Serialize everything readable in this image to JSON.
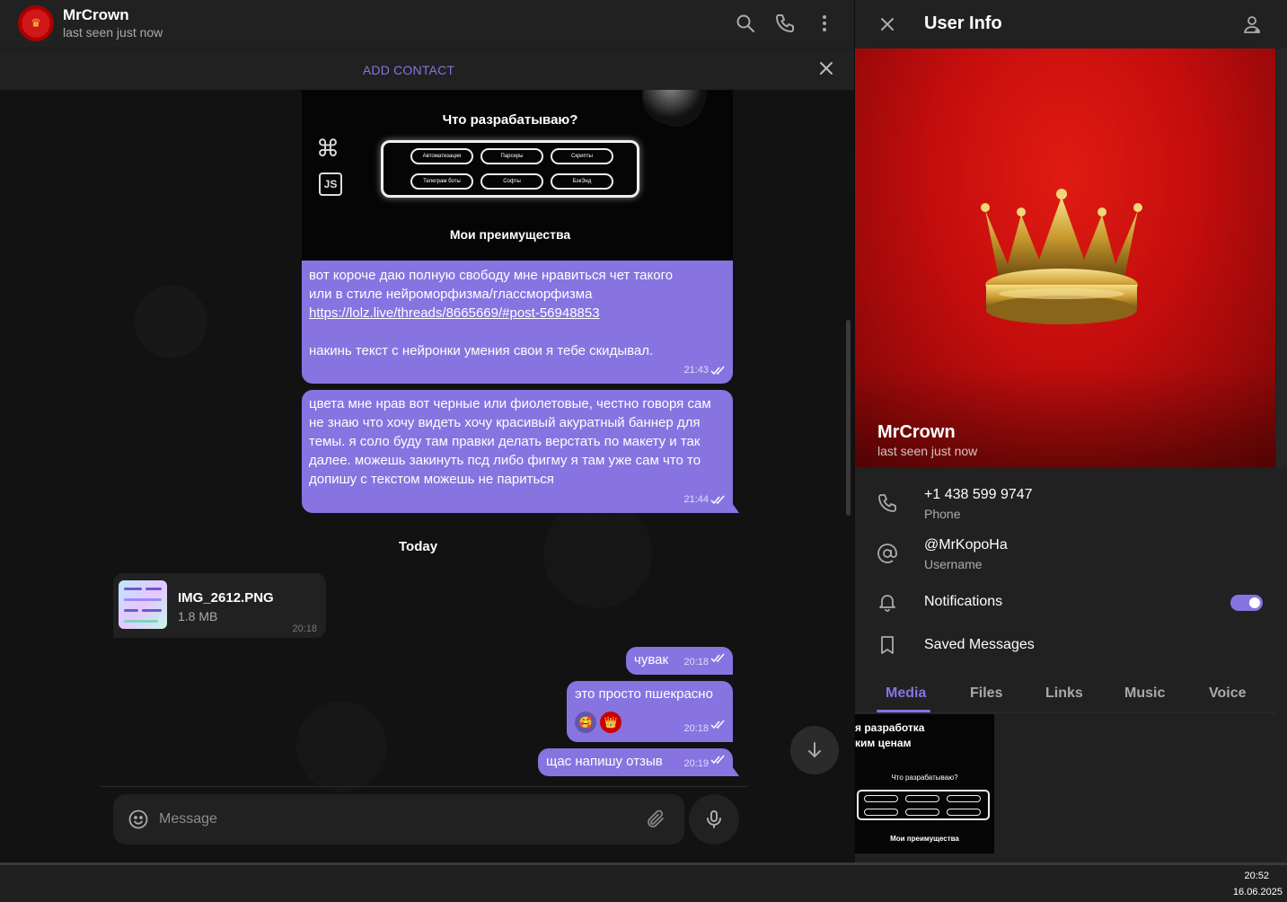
{
  "chat": {
    "peer_name": "MrCrown",
    "peer_status": "last seen just now",
    "add_contact_label": "ADD CONTACT",
    "image_post": {
      "heading1": "Что разрабатываю?",
      "pills": [
        "Автоматизация",
        "Парсеры",
        "Скрипты",
        "Телеграм боты",
        "Софты",
        "БэкЭнд"
      ],
      "heading2": "Мои преимущества"
    },
    "messages": [
      {
        "line1": "вот короче даю полную свободу мне нравиться чет такого",
        "line2": "или в стиле  нейроморфизма/глассморфизма",
        "link": "https://lolz.live/threads/8665669/#post-56948853",
        "line3": "накинь текст с нейронки умения свои я тебе скидывал.",
        "time": "21:43"
      },
      {
        "text": "цвета мне нрав вот черные или фиолетовые, честно говоря сам не знаю что хочу видеть хочу красивый акуратный баннер для темы. я соло буду там правки делать верстать по макету и так далее. можешь закинуть псд либо фигму я там уже сам что то допишу с текстом можешь не париться",
        "time": "21:44"
      }
    ],
    "date_separator": "Today",
    "file": {
      "name": "IMG_2612.PNG",
      "size": "1.8 MB",
      "time": "20:18"
    },
    "short_messages": [
      {
        "text": "чувак",
        "time": "20:18"
      },
      {
        "text": "это просто пшекрасно",
        "time": "20:18",
        "reactions": [
          "🥰",
          "👑"
        ]
      },
      {
        "text": "щас напишу отзыв",
        "time": "20:19"
      }
    ],
    "composer_placeholder": "Message"
  },
  "info": {
    "title": "User Info",
    "name": "MrCrown",
    "status": "last seen just now",
    "phone": "+1 438 599 9747",
    "phone_label": "Phone",
    "username": "@MrKopoHa",
    "username_label": "Username",
    "notifications_label": "Notifications",
    "notifications_on": true,
    "saved_label": "Saved Messages",
    "tabs": [
      "Media",
      "Files",
      "Links",
      "Music",
      "Voice"
    ],
    "active_tab": "Media",
    "media_thumb": {
      "line1": "я разработка",
      "line2": "ким ценам",
      "heading": "Что разрабатываю?",
      "footer": "Мои преимущества"
    }
  },
  "taskbar": {
    "time": "20:52",
    "date": "16.06.2025"
  },
  "colors": {
    "accent": "#8774e1",
    "panel": "#212121",
    "bg": "#121212",
    "profile_red": "#c40d0d"
  }
}
